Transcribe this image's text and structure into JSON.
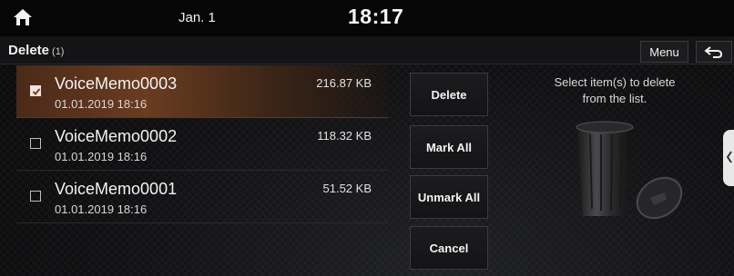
{
  "status_bar": {
    "date": "Jan. 1",
    "time": "18:17"
  },
  "header": {
    "title": "Delete",
    "count": "(1)",
    "menu_label": "Menu",
    "back_icon": "back-arrow-icon"
  },
  "files": [
    {
      "name": "VoiceMemo0003",
      "date": "01.01.2019 18:16",
      "size": "216.87 KB",
      "checked": true
    },
    {
      "name": "VoiceMemo0002",
      "date": "01.01.2019 18:16",
      "size": "118.32 KB",
      "checked": false
    },
    {
      "name": "VoiceMemo0001",
      "date": "01.01.2019 18:16",
      "size": "51.52 KB",
      "checked": false
    }
  ],
  "actions": {
    "delete": "Delete",
    "mark_all": "Mark All",
    "unmark_all": "Unmark All",
    "cancel": "Cancel"
  },
  "hint": {
    "line1": "Select item(s) to delete",
    "line2": "from the list."
  },
  "colors": {
    "selected_row": "#6a3c20",
    "background": "#0b0b0c"
  }
}
